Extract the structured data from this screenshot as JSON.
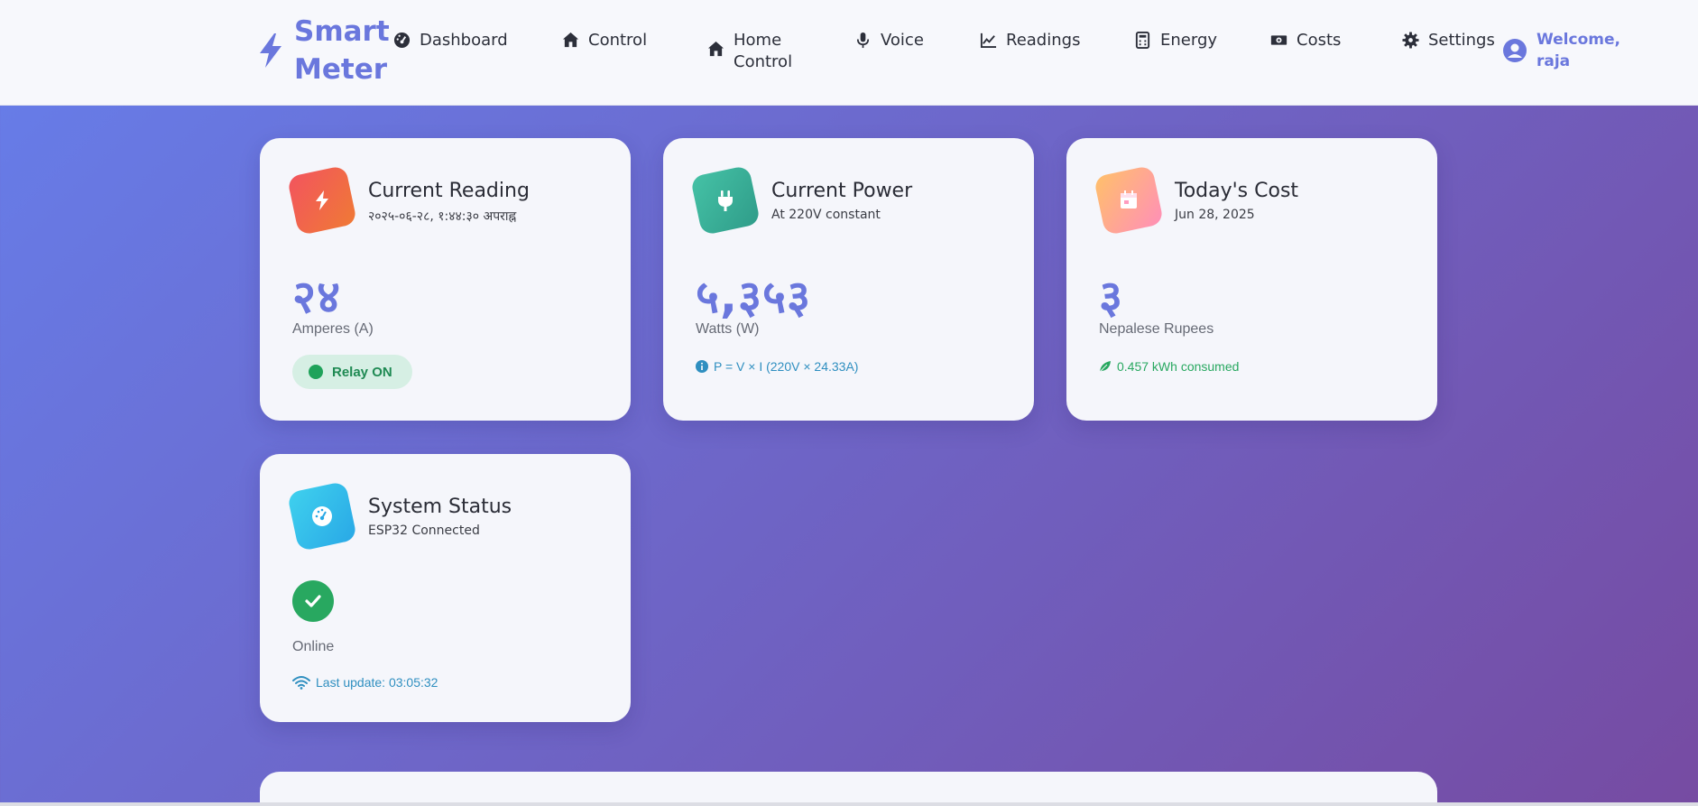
{
  "brand": {
    "line1": "Smart",
    "line2": "Meter"
  },
  "nav": {
    "dashboard": "Dashboard",
    "control": "Control",
    "home_control": "Home\nControl",
    "voice": "Voice",
    "readings": "Readings",
    "energy": "Energy",
    "costs": "Costs",
    "settings": "Settings",
    "welcome": "Welcome,\nraja"
  },
  "cards": {
    "current_reading": {
      "title": "Current Reading",
      "subtitle": "२०२५-०६-२८, १:४४:३० अपराह्न",
      "value": "२४",
      "unit": "Amperes (A)",
      "relay": "Relay ON"
    },
    "current_power": {
      "title": "Current Power",
      "subtitle": "At 220V constant",
      "value": "५,३५३",
      "unit": "Watts (W)",
      "formula": "P = V × I (220V × 24.33A)"
    },
    "todays_cost": {
      "title": "Today's Cost",
      "subtitle": "Jun 28, 2025",
      "value": "३",
      "unit": "Nepalese Rupees",
      "consumed": "0.457 kWh consumed"
    },
    "system_status": {
      "title": "System Status",
      "subtitle": "ESP32 Connected",
      "status": "Online",
      "last_update": "Last update: 03:05:32"
    }
  },
  "colors": {
    "accent": "#6a77dd",
    "bg_gradient_start": "#667eea",
    "bg_gradient_end": "#764ba2",
    "reading_icon": "#f0653f",
    "power_icon": "#3bb39a",
    "cost_icon": "#ffb07a",
    "status_icon": "#3cc7ea",
    "success": "#28a860",
    "info": "#2f8fc0"
  },
  "icons": {
    "brand": "bolt-icon",
    "dashboard": "gauge-icon",
    "control": "home-icon",
    "home_control": "home-icon",
    "voice": "microphone-icon",
    "readings": "line-chart-icon",
    "energy": "calculator-icon",
    "costs": "money-icon",
    "settings": "gear-icon",
    "user": "user-circle-icon"
  }
}
